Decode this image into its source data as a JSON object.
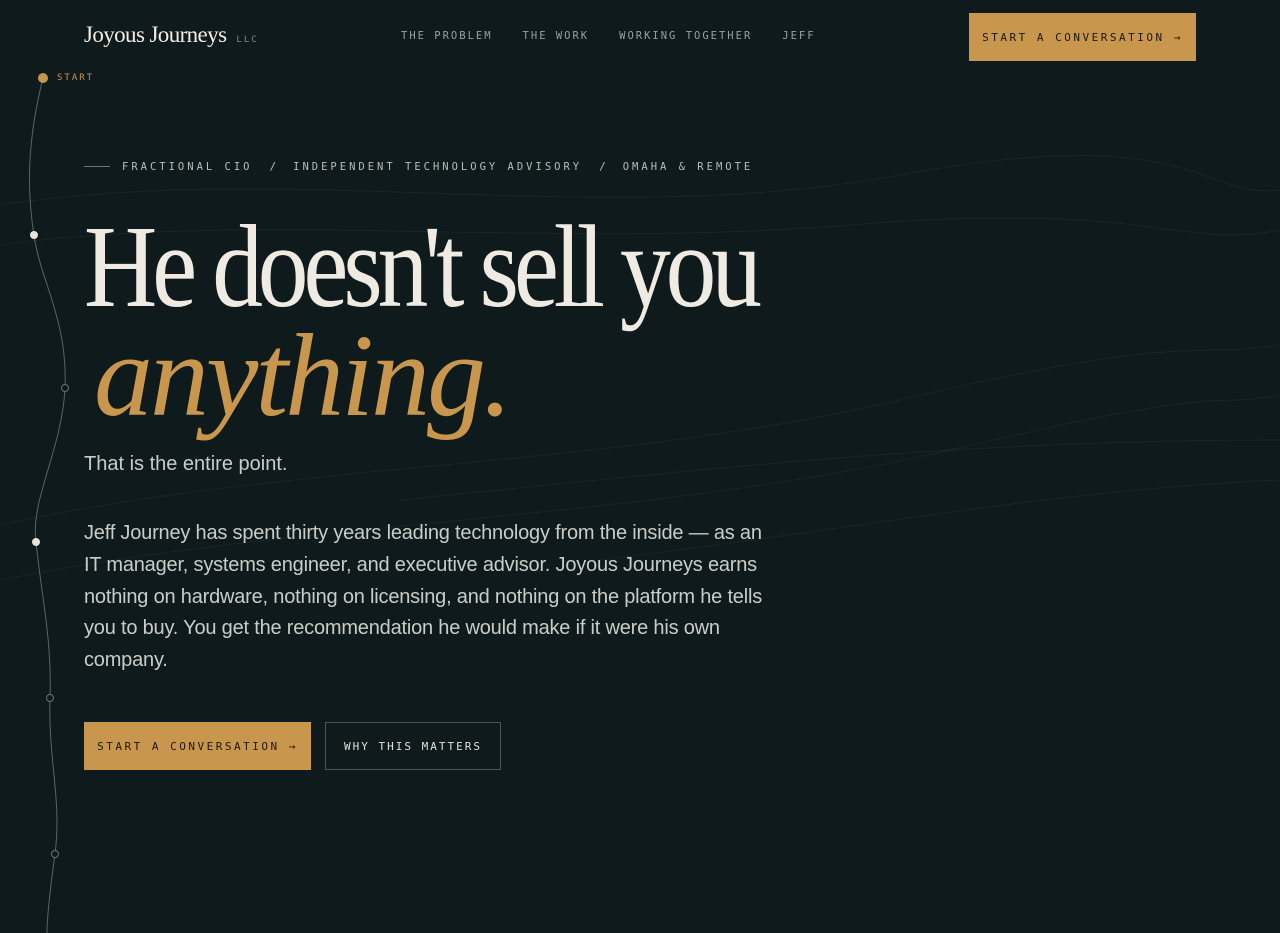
{
  "header": {
    "brand_name": "Joyous Journeys",
    "brand_suffix": "LLC",
    "nav": [
      "THE PROBLEM",
      "THE WORK",
      "WORKING TOGETHER",
      "JEFF"
    ],
    "cta_label": "START A CONVERSATION →"
  },
  "rail": {
    "start_label": "START"
  },
  "hero": {
    "eyebrow": [
      "FRACTIONAL CIO",
      "INDEPENDENT TECHNOLOGY ADVISORY",
      "OMAHA & REMOTE"
    ],
    "eyebrow_separator": "/",
    "headline_line1": "He doesn't sell you",
    "headline_line2": "anything.",
    "lead": "That is the entire point.",
    "body": "Jeff Journey has spent thirty years leading technology from the inside — as an IT manager, systems engineer, and executive advisor. Joyous Journeys earns nothing on hardware, nothing on licensing, and nothing on the platform he tells you to buy. You get the recommendation he would make if it were his own company.",
    "primary_cta": "START A CONVERSATION →",
    "secondary_cta": "WHY THIS MATTERS"
  },
  "colors": {
    "background": "#0e1a1c",
    "accent": "#c8964c",
    "text": "#efebe2",
    "muted_text": "#c9cdc8"
  },
  "icons": {
    "rail_marker": "dot-marker-icon",
    "arrow": "arrow-right-icon"
  }
}
